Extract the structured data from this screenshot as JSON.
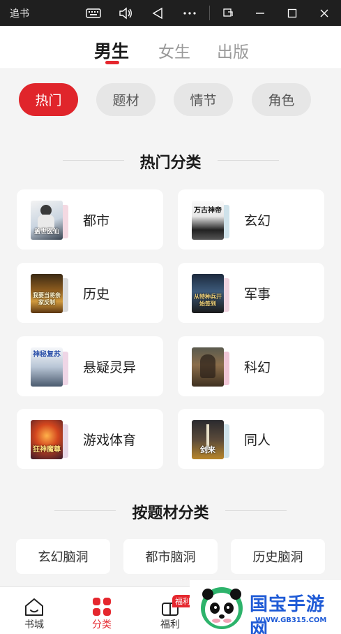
{
  "window": {
    "title": "追书",
    "icons": [
      "keyboard-icon",
      "volume-icon",
      "back-icon",
      "more-icon",
      "rotate-icon",
      "minimize-icon",
      "maximize-icon",
      "close-icon"
    ]
  },
  "gender_tabs": [
    {
      "label": "男生",
      "active": true
    },
    {
      "label": "女生",
      "active": false
    },
    {
      "label": "出版",
      "active": false
    }
  ],
  "filter_chips": [
    {
      "label": "热门",
      "active": true
    },
    {
      "label": "题材",
      "active": false
    },
    {
      "label": "情节",
      "active": false
    },
    {
      "label": "角色",
      "active": false
    }
  ],
  "hot_section": {
    "title": "热门分类",
    "categories": [
      {
        "label": "都市",
        "cover_text": "盖世医仙"
      },
      {
        "label": "玄幻",
        "cover_text": "万古神帝"
      },
      {
        "label": "历史",
        "cover_text": "我要当将亲家反制"
      },
      {
        "label": "军事",
        "cover_text": "从特种兵开始签到"
      },
      {
        "label": "悬疑灵异",
        "cover_text": "神秘复苏"
      },
      {
        "label": "科幻",
        "cover_text": ""
      },
      {
        "label": "游戏体育",
        "cover_text": "狂神魔尊"
      },
      {
        "label": "同人",
        "cover_text": "剑来"
      }
    ]
  },
  "theme_section": {
    "title": "按题材分类",
    "items": [
      "玄幻脑洞",
      "都市脑洞",
      "历史脑洞"
    ]
  },
  "bottom_nav": [
    {
      "label": "书城",
      "icon": "home-icon",
      "active": false
    },
    {
      "label": "分类",
      "icon": "category-icon",
      "active": true
    },
    {
      "label": "福利",
      "icon": "gift-icon",
      "active": false,
      "badge": "福利"
    }
  ],
  "watermark": {
    "text": "国宝手游网",
    "url": "WWW.GB315.COM"
  },
  "colors": {
    "accent": "#e5272e",
    "background": "#f4f4f4",
    "card": "#ffffff"
  }
}
